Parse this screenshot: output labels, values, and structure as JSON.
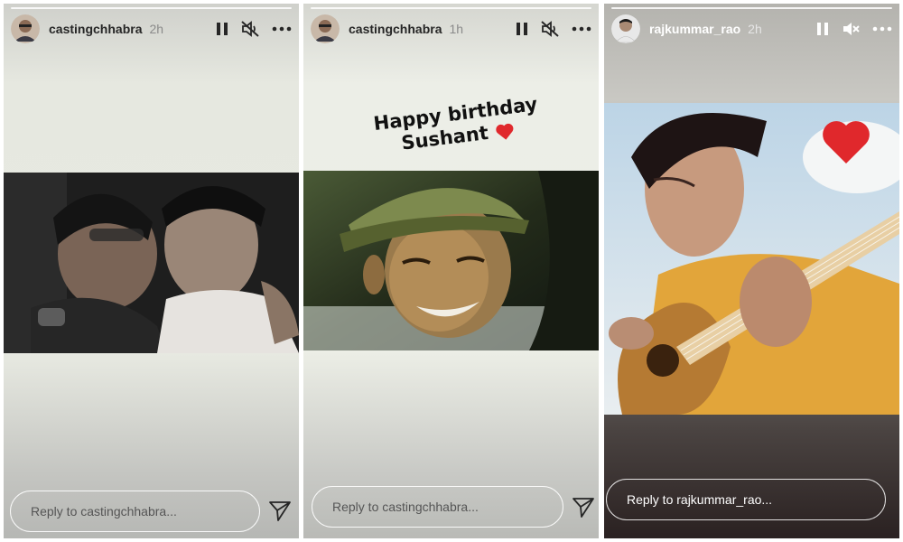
{
  "stories": [
    {
      "username": "castingchhabra",
      "time_ago": "2h",
      "reply_placeholder": "Reply to castingchhabra...",
      "controls": {
        "pause": "pause-icon",
        "sound": "volume-muted-icon",
        "more": "more-options-icon",
        "send": "send-icon"
      }
    },
    {
      "username": "castingchhabra",
      "time_ago": "1h",
      "sticker_text": "Happy birthday",
      "sticker_text_line2": "Sushant",
      "reply_placeholder": "Reply to castingchhabra...",
      "controls": {
        "pause": "pause-icon",
        "sound": "volume-muted-icon",
        "more": "more-options-icon",
        "send": "send-icon"
      }
    },
    {
      "username": "rajkummar_rao",
      "time_ago": "2h",
      "reply_placeholder": "Reply to rajkummar_rao...",
      "controls": {
        "pause": "pause-icon",
        "sound": "volume-muted-icon",
        "more": "more-options-icon"
      }
    }
  ],
  "colors": {
    "heart": "#e0282c",
    "text_dark": "#262626",
    "text_light": "#ffffff"
  }
}
